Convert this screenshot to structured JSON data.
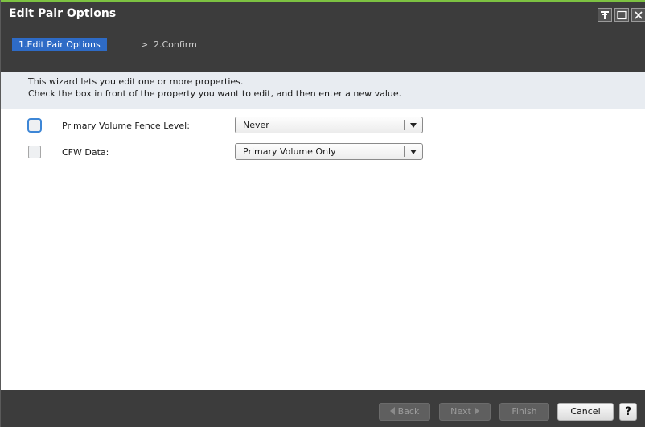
{
  "window": {
    "title": "Edit Pair Options",
    "controls": [
      "pin-icon",
      "maximize-icon",
      "close-icon"
    ]
  },
  "wizard": {
    "steps": [
      {
        "label": "1.Edit Pair Options",
        "active": true
      },
      {
        "label": "2.Confirm",
        "active": false
      }
    ],
    "separator": ">"
  },
  "instructions": {
    "line1": "This wizard lets you edit one or more properties.",
    "line2": "Check the box in front of the property you want to edit, and then enter a new value."
  },
  "properties": [
    {
      "label": "Primary Volume Fence Level:",
      "value": "Never",
      "checked": false,
      "focused": true
    },
    {
      "label": "CFW Data:",
      "value": "Primary Volume Only",
      "checked": false,
      "focused": false
    }
  ],
  "footer": {
    "back_label": "Back",
    "next_label": "Next",
    "finish_label": "Finish",
    "cancel_label": "Cancel",
    "help_label": "?"
  },
  "colors": {
    "accent": "#7dc242",
    "titlebar": "#3c3c3c",
    "active_step": "#2e6bc6",
    "instructions_bg": "#e8ecf1"
  }
}
